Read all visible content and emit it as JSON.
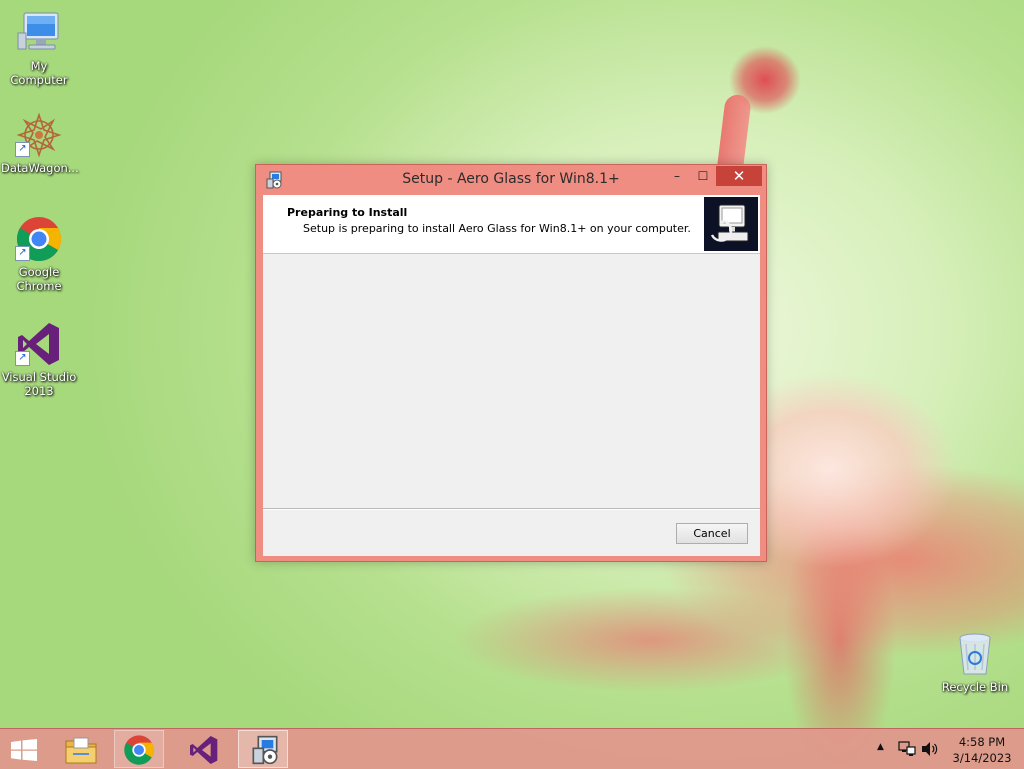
{
  "desktop": {
    "icons": [
      {
        "label": "My Computer",
        "icon": "computer-icon"
      },
      {
        "label": "DataWagon...",
        "icon": "datawagon-icon"
      },
      {
        "label": "Google Chrome",
        "icon": "chrome-icon"
      },
      {
        "label": "Visual Studio 2013",
        "icon": "visual-studio-icon"
      },
      {
        "label": "Recycle Bin",
        "icon": "recycle-bin-icon"
      }
    ]
  },
  "window": {
    "title": "Setup - Aero Glass for Win8.1+",
    "controls": {
      "minimize": "–",
      "maximize": "☐",
      "close": "✕"
    },
    "header": {
      "title": "Preparing to Install",
      "subtitle": "Setup is preparing to install Aero Glass for Win8.1+ on your computer."
    },
    "cancel_label": "Cancel"
  },
  "taskbar": {
    "items": [
      {
        "name": "start-button",
        "icon": "windows-logo-icon"
      },
      {
        "name": "file-explorer",
        "icon": "folder-icon"
      },
      {
        "name": "google-chrome",
        "icon": "chrome-icon"
      },
      {
        "name": "visual-studio",
        "icon": "visual-studio-icon"
      },
      {
        "name": "setup-app",
        "icon": "setup-installer-icon",
        "running": true
      }
    ],
    "tray": {
      "overflow": "▲",
      "time": "4:58 PM",
      "date": "3/14/2023"
    }
  },
  "colors": {
    "window_frame": "#ef8d82",
    "close_button": "#c7433a",
    "taskbar": "#e1968c"
  }
}
